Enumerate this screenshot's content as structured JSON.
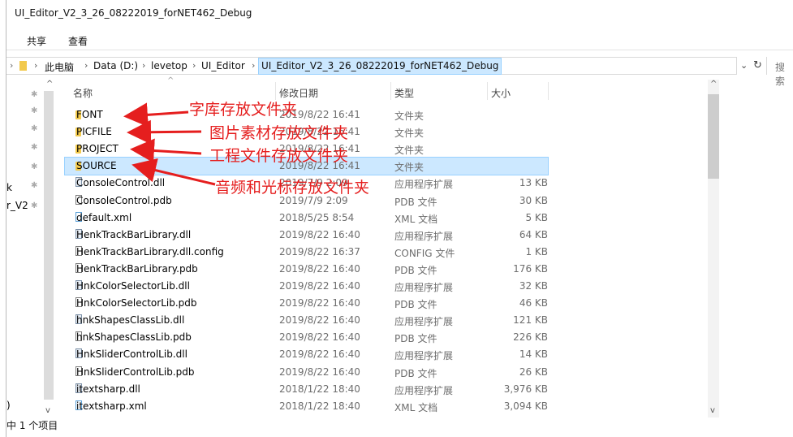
{
  "window": {
    "title": "UI_Editor_V2_3_26_08222019_forNET462_Debug"
  },
  "ribbon": {
    "tab_share": "共享",
    "tab_view": "查看"
  },
  "address": {
    "items": [
      "此电脑",
      "Data (D:)",
      "levetop",
      "UI_Editor",
      "UI_Editor_V2_3_26_08222019_forNET462_Debug"
    ],
    "search_placeholder": "搜索"
  },
  "nav": {
    "partial_labels": [
      "k",
      "r_V2",
      ")"
    ]
  },
  "columns": {
    "name": "名称",
    "date": "修改日期",
    "type": "类型",
    "size": "大小"
  },
  "files": [
    {
      "name": "FONT",
      "date": "2019/8/22 16:41",
      "type": "文件夹",
      "size": "",
      "icon": "folder-icon"
    },
    {
      "name": "PICFILE",
      "date": "2019/8/22 16:41",
      "type": "文件夹",
      "size": "",
      "icon": "folder-icon"
    },
    {
      "name": "PROJECT",
      "date": "2019/8/22 16:41",
      "type": "文件夹",
      "size": "",
      "icon": "folder-icon"
    },
    {
      "name": "SOURCE",
      "date": "2019/8/22 16:41",
      "type": "文件夹",
      "size": "",
      "icon": "folder-icon",
      "selected": true
    },
    {
      "name": "ConsoleControl.dll",
      "date": "2019/7/9 2:09",
      "type": "应用程序扩展",
      "size": "13 KB",
      "icon": "dll-icon"
    },
    {
      "name": "ConsoleControl.pdb",
      "date": "2019/7/9 2:09",
      "type": "PDB 文件",
      "size": "30 KB",
      "icon": "file-icon"
    },
    {
      "name": "default.xml",
      "date": "2018/5/25 8:54",
      "type": "XML 文档",
      "size": "5 KB",
      "icon": "xml-icon"
    },
    {
      "name": "HenkTrackBarLibrary.dll",
      "date": "2019/8/22 16:40",
      "type": "应用程序扩展",
      "size": "64 KB",
      "icon": "dll-icon"
    },
    {
      "name": "HenkTrackBarLibrary.dll.config",
      "date": "2019/8/22 16:37",
      "type": "CONFIG 文件",
      "size": "1 KB",
      "icon": "file-icon"
    },
    {
      "name": "HenkTrackBarLibrary.pdb",
      "date": "2019/8/22 16:40",
      "type": "PDB 文件",
      "size": "176 KB",
      "icon": "file-icon"
    },
    {
      "name": "HnkColorSelectorLib.dll",
      "date": "2019/8/22 16:40",
      "type": "应用程序扩展",
      "size": "32 KB",
      "icon": "dll-icon"
    },
    {
      "name": "HnkColorSelectorLib.pdb",
      "date": "2019/8/22 16:40",
      "type": "PDB 文件",
      "size": "46 KB",
      "icon": "file-icon"
    },
    {
      "name": "hnkShapesClassLib.dll",
      "date": "2019/8/22 16:40",
      "type": "应用程序扩展",
      "size": "121 KB",
      "icon": "dll-icon"
    },
    {
      "name": "hnkShapesClassLib.pdb",
      "date": "2019/8/22 16:40",
      "type": "PDB 文件",
      "size": "226 KB",
      "icon": "file-icon"
    },
    {
      "name": "HnkSliderControlLib.dll",
      "date": "2019/8/22 16:40",
      "type": "应用程序扩展",
      "size": "14 KB",
      "icon": "dll-icon"
    },
    {
      "name": "HnkSliderControlLib.pdb",
      "date": "2019/8/22 16:40",
      "type": "PDB 文件",
      "size": "26 KB",
      "icon": "file-icon"
    },
    {
      "name": "itextsharp.dll",
      "date": "2018/1/22 18:40",
      "type": "应用程序扩展",
      "size": "3,976 KB",
      "icon": "dll-icon"
    },
    {
      "name": "itextsharp.xml",
      "date": "2018/1/22 18:40",
      "type": "XML 文档",
      "size": "3,094 KB",
      "icon": "xml-icon"
    }
  ],
  "annotations": [
    "字库存放文件夹",
    "图片素材存放文件夹",
    "工程文件存放文件夹",
    "音频和光标存放文件夹"
  ],
  "status": {
    "text": "中 1 个项目"
  },
  "colors": {
    "annotation": "#e51e1e",
    "selection": "#cce8ff",
    "folder": "#f2c94c"
  }
}
